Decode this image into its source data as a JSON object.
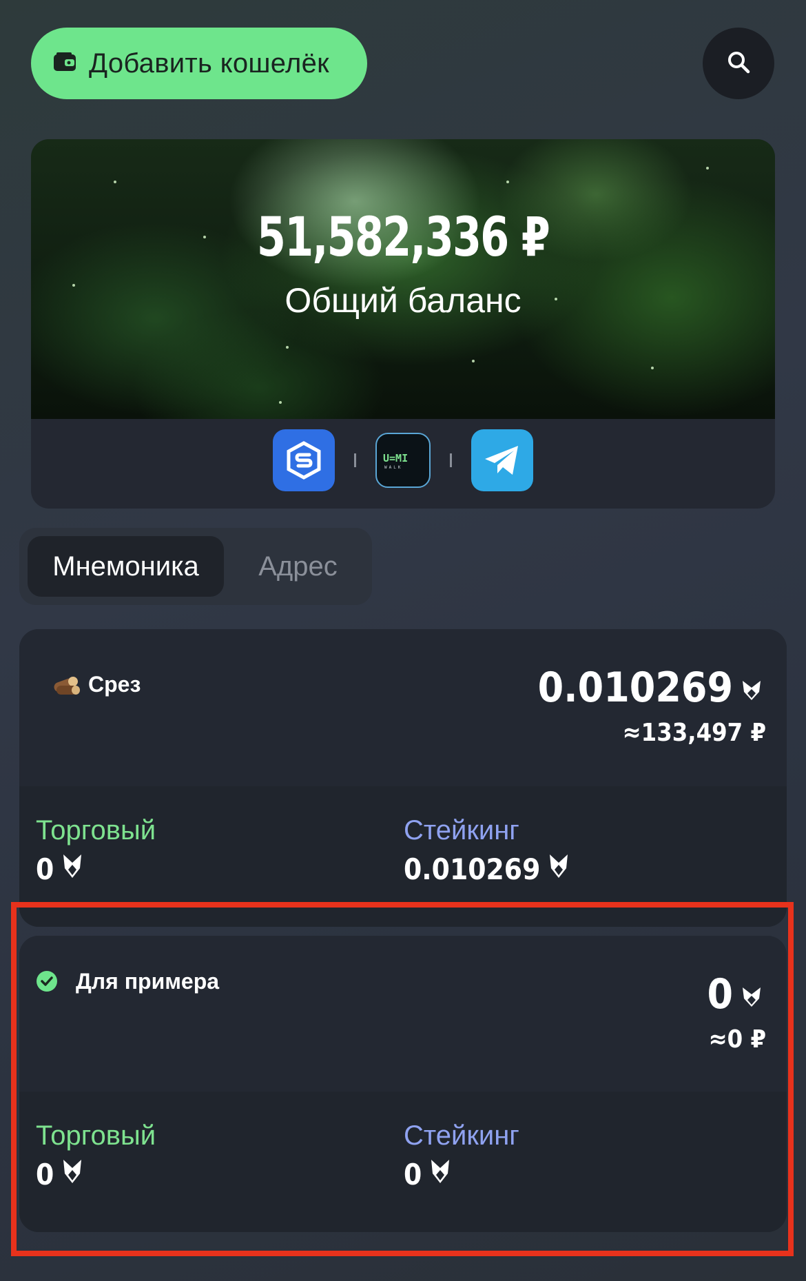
{
  "header": {
    "add_wallet_label": "Добавить кошелёк",
    "search_icon": "search-icon",
    "wallet_icon": "wallet-icon"
  },
  "banner": {
    "balance_amount": "51,582,336 ₽",
    "balance_label": "Общий баланс",
    "apps": [
      {
        "name": "sweat-app",
        "color": "#2f6fe4"
      },
      {
        "name": "ummi-walk-app",
        "color": "#0b1217"
      },
      {
        "name": "telegram-app",
        "color": "#2ea9e6"
      }
    ]
  },
  "tabs": {
    "items": [
      "Мнемоника",
      "Адрес"
    ],
    "active": "Мнемоника"
  },
  "wallets": [
    {
      "icon": "logs-emoji-icon",
      "name": "Срез",
      "amount": "0.010269",
      "fiat": "≈133,497 ₽",
      "trading_label": "Торговый",
      "trading_value": "0",
      "staking_label": "Стейкинг",
      "staking_value": "0.010269"
    },
    {
      "icon": "check-circle-icon",
      "name": "Для примера",
      "amount": "0",
      "fiat": "≈0 ₽",
      "trading_label": "Торговый",
      "trading_value": "0",
      "staking_label": "Стейкинг",
      "staking_value": "0"
    }
  ],
  "colors": {
    "accent_green": "#6ee58c",
    "staking_blue": "#8fa2f0",
    "highlight_red": "#e8321c"
  }
}
